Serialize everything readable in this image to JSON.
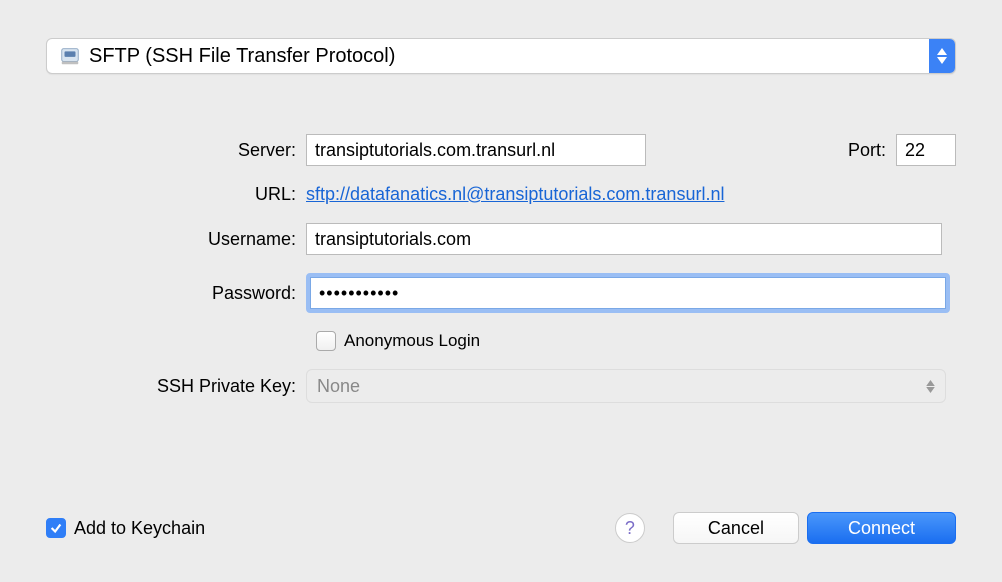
{
  "protocol": {
    "label": "SFTP (SSH File Transfer Protocol)"
  },
  "labels": {
    "server": "Server:",
    "port": "Port:",
    "url": "URL:",
    "username": "Username:",
    "password": "Password:",
    "anonymous": "Anonymous Login",
    "sshKey": "SSH Private Key:",
    "keychain": "Add to Keychain",
    "cancel": "Cancel",
    "connect": "Connect",
    "help": "?"
  },
  "values": {
    "server": "transiptutorials.com.transurl.nl",
    "port": "22",
    "url": "sftp://datafanatics.nl@transiptutorials.com.transurl.nl",
    "username": "transiptutorials.com",
    "password": "•••••••••••",
    "sshKey": "None"
  },
  "state": {
    "anonymousChecked": false,
    "keychainChecked": true
  }
}
